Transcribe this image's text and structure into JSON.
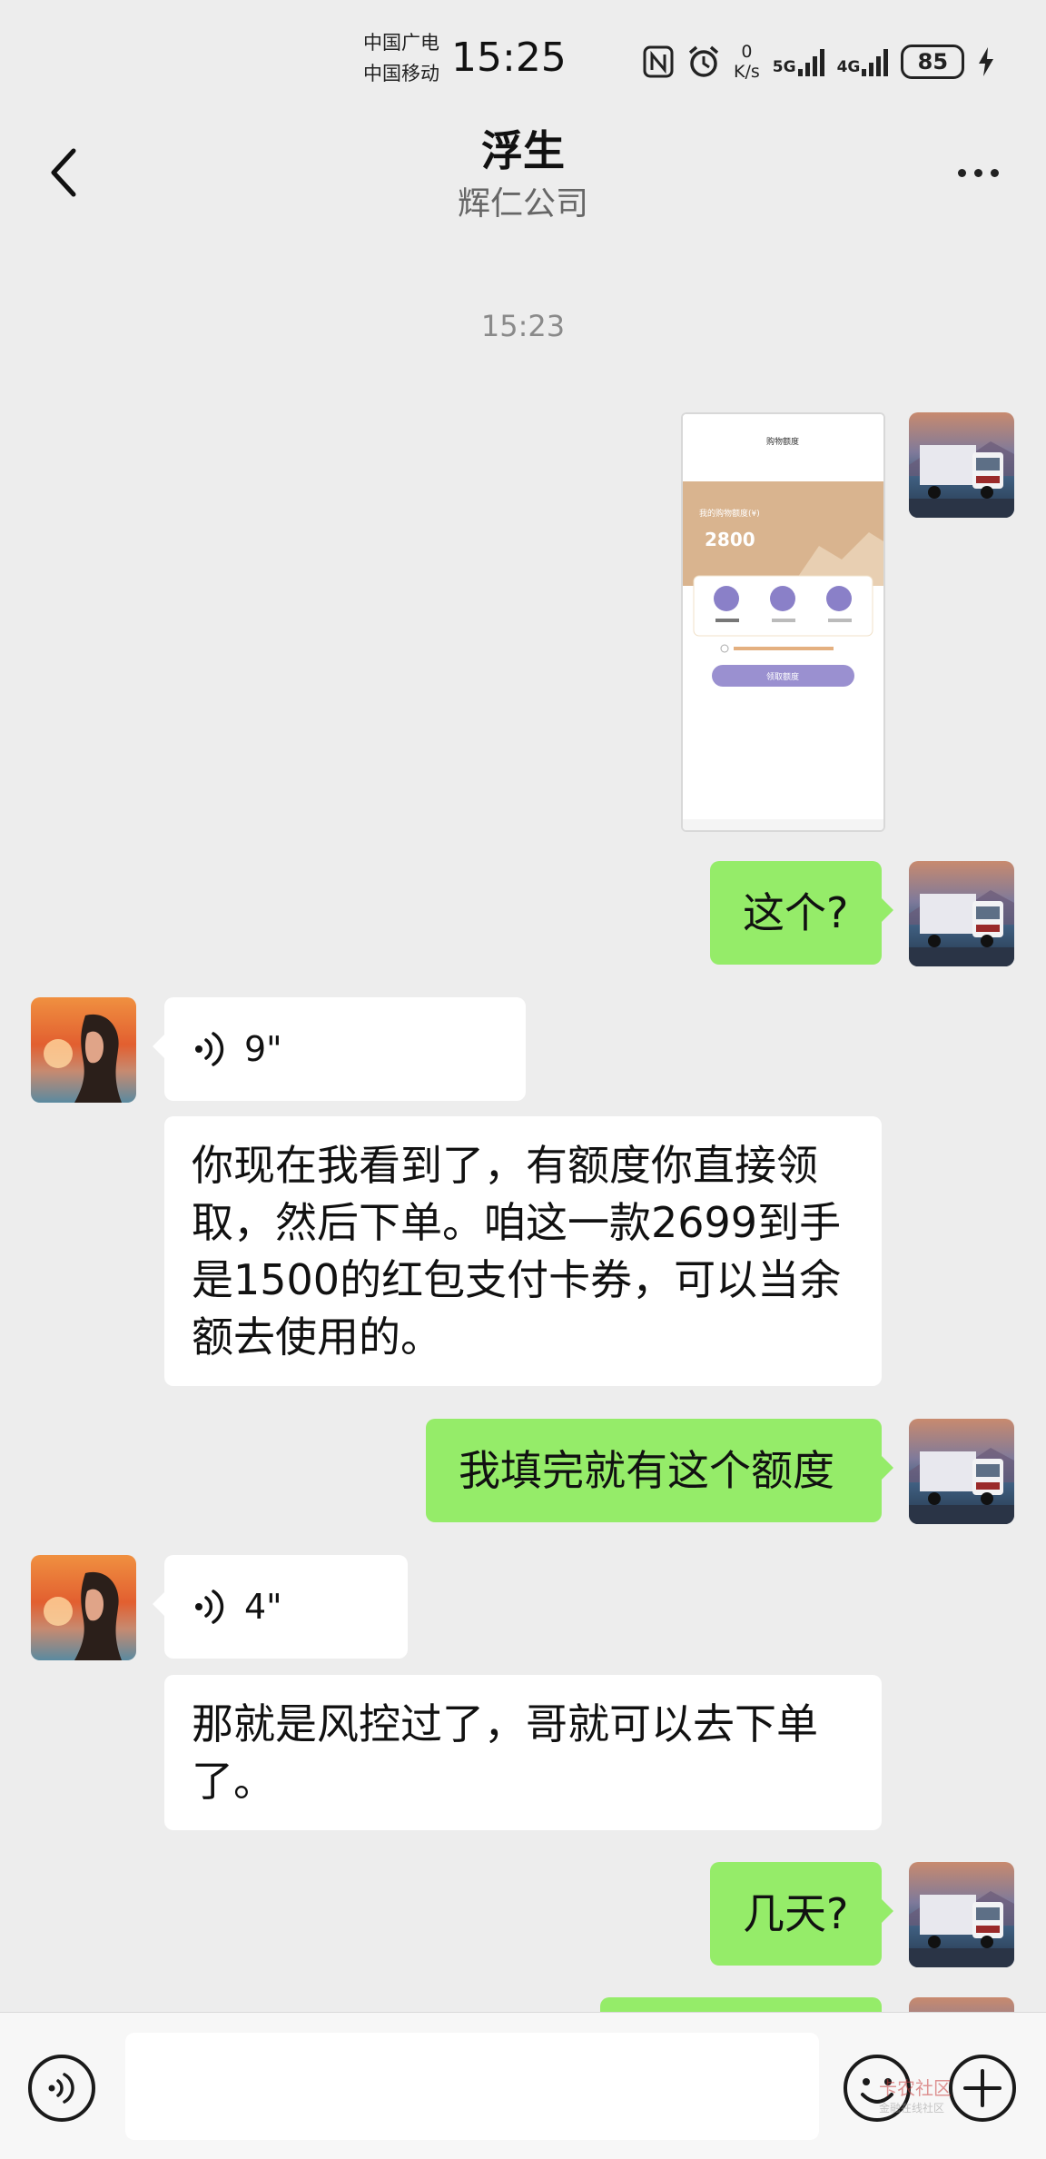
{
  "status_bar": {
    "carrier_1": "中国广电",
    "carrier_2": "中国移动",
    "time": "15:25",
    "net_speed_value": "0",
    "net_speed_unit": "K/s",
    "signal_1_label": "5G",
    "signal_2_label": "4G",
    "battery": "85",
    "icons": [
      "nfc-icon",
      "alarm-icon",
      "signal-icon",
      "charging-icon"
    ]
  },
  "header": {
    "title": "浮生",
    "subtitle": "辉仁公司",
    "back_icon": "chevron-left-icon",
    "more_icon": "more-dots-icon"
  },
  "chat": {
    "timestamp": "15:23",
    "messages": [
      {
        "sender": "me",
        "type": "image",
        "description_icon": "screenshot-thumbnail",
        "image_text": {
          "title": "购物额度",
          "amount_label": "我的购物额度(¥)",
          "amount": "2800",
          "button": "领取额度"
        }
      },
      {
        "sender": "me",
        "type": "text",
        "text": "这个?"
      },
      {
        "sender": "other",
        "type": "voice",
        "duration": "9\""
      },
      {
        "sender": "other",
        "type": "text",
        "lines": [
          "你现在我看到了，有额度你直接领",
          "取，然后下单。咱这一款2699到手",
          "是1500的红包支付卡券，可以当余",
          "额去使用的。"
        ]
      },
      {
        "sender": "me",
        "type": "text",
        "text": "我填完就有这个额度"
      },
      {
        "sender": "other",
        "type": "voice",
        "duration": "4\""
      },
      {
        "sender": "other",
        "type": "text",
        "lines": [
          "那就是风控过了，哥就可以去下单",
          "了。"
        ]
      },
      {
        "sender": "me",
        "type": "text",
        "text": "几天?"
      }
    ]
  },
  "input_bar": {
    "voice_icon": "voice-toggle-icon",
    "emoji_icon": "emoji-icon",
    "plus_icon": "plus-icon",
    "input_value": "",
    "watermark": "卡农社区",
    "watermark_sub": "金融在线社区"
  },
  "colors": {
    "background": "#ededed",
    "my_bubble": "#95ec69",
    "their_bubble": "#ffffff",
    "input_bar": "#f7f7f7"
  }
}
